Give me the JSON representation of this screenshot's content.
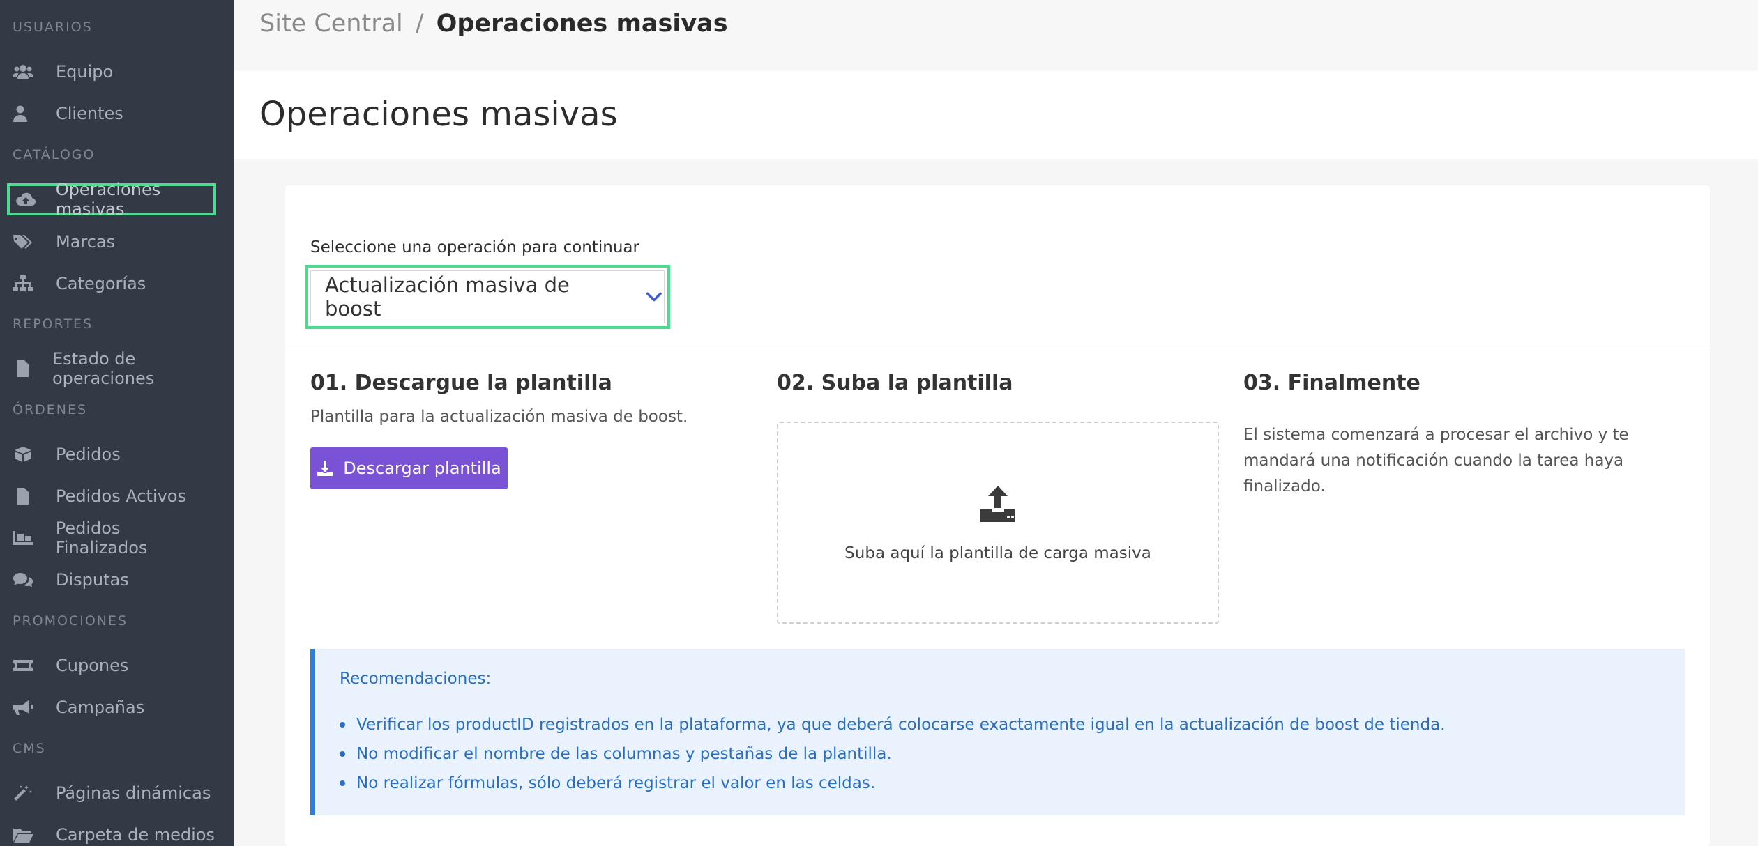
{
  "sidebar": {
    "sections": [
      {
        "title": "USUARIOS",
        "items": [
          {
            "label": "Equipo",
            "icon": "users-icon"
          },
          {
            "label": "Clientes",
            "icon": "user-icon"
          }
        ]
      },
      {
        "title": "CATÁLOGO",
        "items": [
          {
            "label": "Operaciones masivas",
            "icon": "cloud-upload-icon",
            "active": true
          },
          {
            "label": "Marcas",
            "icon": "tags-icon"
          },
          {
            "label": "Categorías",
            "icon": "sitemap-icon"
          }
        ]
      },
      {
        "title": "REPORTES",
        "items": [
          {
            "label": "Estado de operaciones",
            "icon": "file-report-icon"
          }
        ]
      },
      {
        "title": "ÓRDENES",
        "items": [
          {
            "label": "Pedidos",
            "icon": "box-icon"
          },
          {
            "label": "Pedidos Activos",
            "icon": "file-icon"
          },
          {
            "label": "Pedidos Finalizados",
            "icon": "pallet-icon"
          },
          {
            "label": "Disputas",
            "icon": "comments-icon"
          }
        ]
      },
      {
        "title": "PROMOCIONES",
        "items": [
          {
            "label": "Cupones",
            "icon": "ticket-icon"
          },
          {
            "label": "Campañas",
            "icon": "megaphone-icon"
          }
        ]
      },
      {
        "title": "CMS",
        "items": [
          {
            "label": "Páginas dinámicas",
            "icon": "magic-wand-icon"
          },
          {
            "label": "Carpeta de medios",
            "icon": "folder-icon"
          }
        ]
      }
    ]
  },
  "breadcrumb": {
    "parent": "Site Central",
    "separator": "/",
    "current": "Operaciones masivas"
  },
  "page": {
    "title": "Operaciones masivas"
  },
  "operation": {
    "label": "Seleccione una operación para continuar",
    "selected": "Actualización masiva de boost"
  },
  "steps": {
    "step1": {
      "title": "01. Descargue la plantilla",
      "description": "Plantilla para la actualización masiva de boost.",
      "button": "Descargar plantilla"
    },
    "step2": {
      "title": "02. Suba la plantilla",
      "dropzone_text": "Suba aquí la plantilla de carga masiva"
    },
    "step3": {
      "title": "03. Finalmente",
      "description": "El sistema comenzará a procesar el archivo y te mandará una notificación cuando la tarea haya finalizado."
    }
  },
  "recommendations": {
    "title": "Recomendaciones:",
    "items": [
      "Verificar los productID registrados en la plataforma, ya que deberá colocarse exactamente igual en la actualización de boost de tienda.",
      "No modificar el nombre de las columnas y pestañas de la plantilla.",
      "No realizar fórmulas, sólo deberá registrar el valor en las celdas."
    ]
  },
  "colors": {
    "sidebar_bg": "#333a45",
    "highlight": "#4ddc8f",
    "primary_button": "#7952d6",
    "info_text": "#2a6fbf",
    "info_bg": "#eaf3fd"
  }
}
